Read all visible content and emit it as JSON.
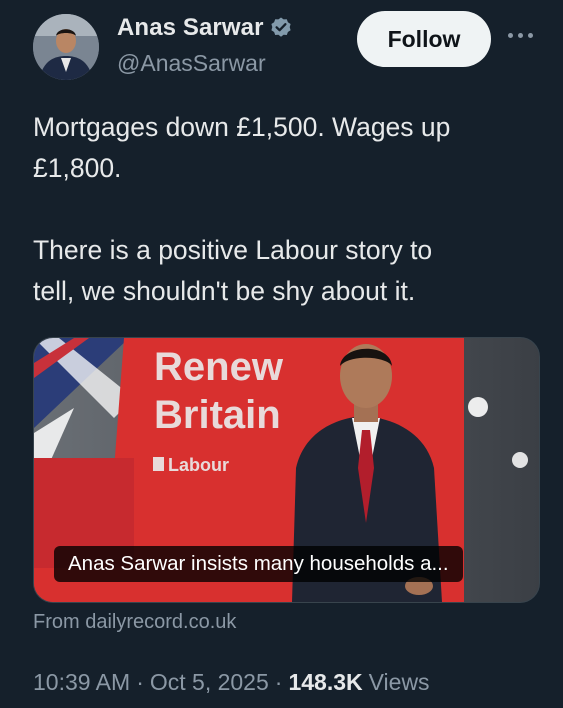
{
  "author": {
    "name": "Anas Sarwar",
    "handle": "@AnasSarwar",
    "verified": true
  },
  "actions": {
    "follow_label": "Follow",
    "more_icon": "more-horizontal-icon"
  },
  "tweet": {
    "text": "Mortgages down £1,500. Wages up\n£1,800.\n\nThere is a positive Labour story to\ntell, we shouldn't be shy about it."
  },
  "card": {
    "image_sign_text": {
      "line1": "Renew",
      "line2": "Britain",
      "logo": "Labour"
    },
    "caption": "Anas Sarwar insists many households a...",
    "source": "From dailyrecord.co.uk"
  },
  "meta": {
    "time": "10:39 AM",
    "date": "Oct 5, 2025",
    "views_count": "148.3K",
    "views_label": "Views"
  },
  "colors": {
    "background": "#15202b",
    "verified_badge": "#829aab",
    "follow_bg": "#eff3f4",
    "labour_red": "#d8302f"
  }
}
